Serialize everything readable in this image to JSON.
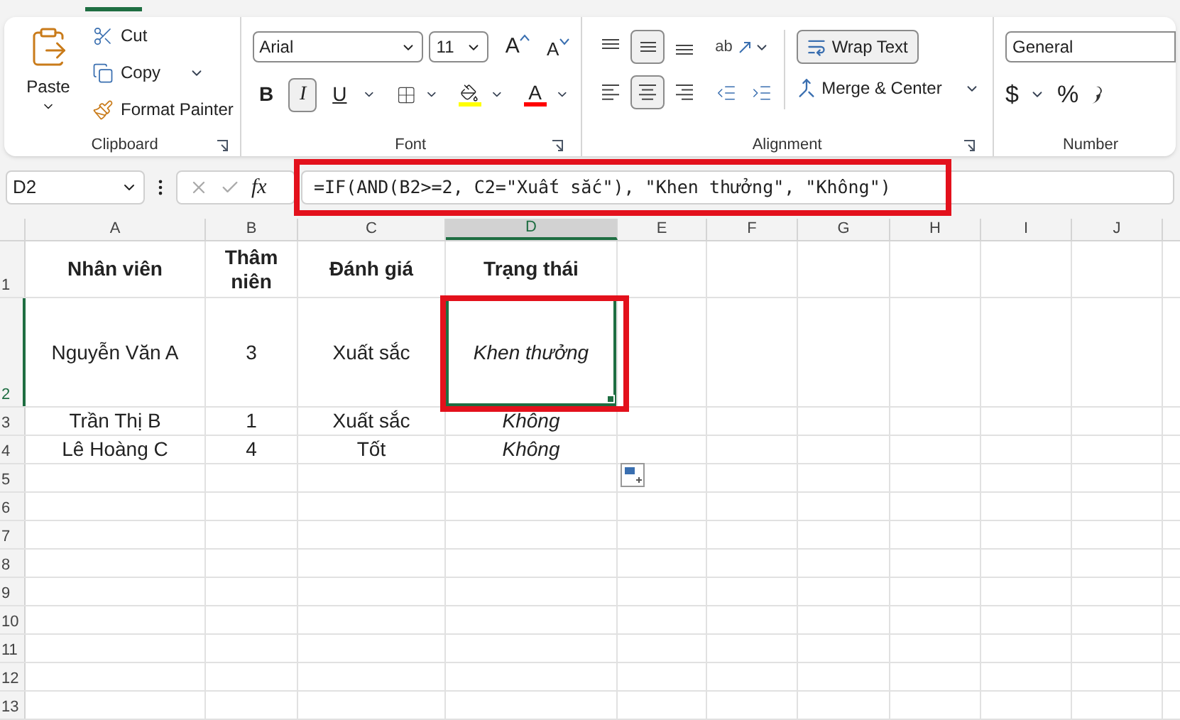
{
  "ribbon": {
    "groups": [
      {
        "kind": "clipboard",
        "label": "Clipboard",
        "paste": "Paste",
        "items": [
          {
            "kind": "cut",
            "label": "Cut"
          },
          {
            "kind": "copy",
            "label": "Copy"
          },
          {
            "kind": "painter",
            "label": "Format Painter"
          }
        ]
      },
      {
        "kind": "font",
        "label": "Font",
        "font": "Arial",
        "size": "11",
        "grow": "A",
        "shrink": "A",
        "styles": [
          {
            "label": "B",
            "kind": "bold",
            "pressed": false
          },
          {
            "label": "I",
            "kind": "italic",
            "pressed": true
          },
          {
            "label": "U",
            "kind": "underline",
            "pressed": false
          }
        ],
        "font_color": "A"
      },
      {
        "kind": "alignment",
        "label": "Alignment",
        "vertical": [
          {
            "kind": "top",
            "selected": false
          },
          {
            "kind": "middle",
            "selected": true
          },
          {
            "kind": "bottom",
            "selected": false
          }
        ],
        "horizontal": [
          {
            "kind": "left",
            "selected": false
          },
          {
            "kind": "center",
            "selected": true
          },
          {
            "kind": "right",
            "selected": false
          }
        ],
        "orientation": "ab",
        "wrap_text": {
          "label": "Wrap Text",
          "pressed": true
        },
        "merge": "Merge & Center"
      },
      {
        "kind": "number",
        "label": "Number",
        "format": "General",
        "currency": "$",
        "percent": "%"
      }
    ]
  },
  "formula_bar": {
    "name_box": "D2",
    "fx": "fx",
    "formula": "=IF(AND(B2>=2, C2=\"Xuất sắc\"), \"Khen thưởng\", \"Không\")"
  },
  "columns": [
    {
      "label": "A",
      "selected": false
    },
    {
      "label": "B",
      "selected": false
    },
    {
      "label": "C",
      "selected": false
    },
    {
      "label": "D",
      "selected": true
    },
    {
      "label": "E",
      "selected": false
    },
    {
      "label": "F",
      "selected": false
    },
    {
      "label": "G",
      "selected": false
    },
    {
      "label": "H",
      "selected": false
    },
    {
      "label": "I",
      "selected": false
    },
    {
      "label": "J",
      "selected": false
    }
  ],
  "rows": [
    {
      "label": "1",
      "selected": false,
      "kind": "header",
      "cells": [
        {
          "text": "Nhân viên",
          "kind": "heading",
          "selected": false
        },
        {
          "text": "Thâm niên",
          "kind": "heading",
          "selected": false
        },
        {
          "text": "Đánh giá",
          "kind": "heading",
          "selected": false
        },
        {
          "text": "Trạng thái",
          "kind": "heading",
          "selected": false
        }
      ]
    },
    {
      "label": "2",
      "selected": true,
      "kind": "tall",
      "cells": [
        {
          "text": "Nguyễn Văn A",
          "kind": "text",
          "selected": false
        },
        {
          "text": "3",
          "kind": "text",
          "selected": false
        },
        {
          "text": "Xuất sắc",
          "kind": "text",
          "selected": false
        },
        {
          "text": "Khen thưởng",
          "kind": "result",
          "selected": true
        }
      ]
    },
    {
      "label": "3",
      "selected": false,
      "kind": "plain",
      "cells": [
        {
          "text": "Trần Thị B",
          "kind": "text",
          "selected": false
        },
        {
          "text": "1",
          "kind": "text",
          "selected": false
        },
        {
          "text": "Xuất sắc",
          "kind": "text",
          "selected": false
        },
        {
          "text": "Không",
          "kind": "result",
          "selected": false
        }
      ]
    },
    {
      "label": "4",
      "selected": false,
      "kind": "plain",
      "cells": [
        {
          "text": "Lê Hoàng C",
          "kind": "text",
          "selected": false
        },
        {
          "text": "4",
          "kind": "text",
          "selected": false
        },
        {
          "text": "Tốt",
          "kind": "text",
          "selected": false
        },
        {
          "text": "Không",
          "kind": "result",
          "selected": false
        }
      ]
    },
    {
      "label": "5",
      "selected": false,
      "kind": "plain",
      "cells": []
    },
    {
      "label": "6",
      "selected": false,
      "kind": "plain",
      "cells": []
    },
    {
      "label": "7",
      "selected": false,
      "kind": "plain",
      "cells": []
    },
    {
      "label": "8",
      "selected": false,
      "kind": "plain",
      "cells": []
    },
    {
      "label": "9",
      "selected": false,
      "kind": "plain",
      "cells": []
    },
    {
      "label": "10",
      "selected": false,
      "kind": "plain",
      "cells": []
    },
    {
      "label": "11",
      "selected": false,
      "kind": "plain",
      "cells": []
    },
    {
      "label": "12",
      "selected": false,
      "kind": "plain",
      "cells": []
    },
    {
      "label": "13",
      "selected": false,
      "kind": "plain",
      "cells": []
    }
  ]
}
